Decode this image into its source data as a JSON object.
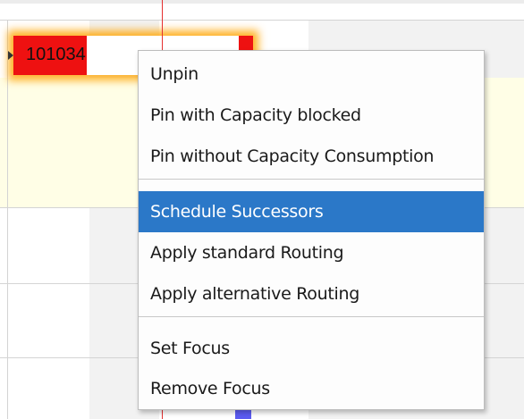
{
  "gantt": {
    "order_bar_label": "101034"
  },
  "context_menu": {
    "groups": [
      [
        {
          "label": "Unpin"
        },
        {
          "label": "Pin with Capacity blocked"
        },
        {
          "label": "Pin without Capacity Consumption"
        }
      ],
      [
        {
          "label": "Schedule Successors",
          "selected": true
        },
        {
          "label": "Apply standard Routing"
        },
        {
          "label": "Apply alternative Routing"
        }
      ],
      [
        {
          "label": "Set Focus"
        },
        {
          "label": "Remove Focus"
        }
      ]
    ]
  },
  "colors": {
    "selection": "#2b78c8",
    "order_bar": "#ee1111",
    "highlight_glow": "#ffa500",
    "current_time_line": "#e53030",
    "row_highlight": "#fffee6"
  }
}
